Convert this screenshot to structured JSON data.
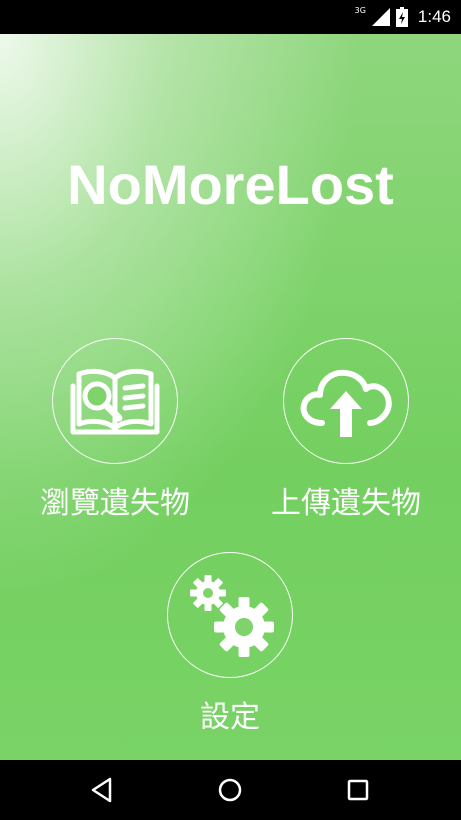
{
  "status_bar": {
    "network": "3G",
    "time": "1:46"
  },
  "app": {
    "title": "NoMoreLost",
    "background_color": "#7ed36b",
    "menu": {
      "browse_label": "瀏覽遺失物",
      "upload_label": "上傳遺失物",
      "settings_label": "設定"
    }
  },
  "icons": {
    "browse": "book-search-icon",
    "upload": "cloud-upload-icon",
    "settings": "gears-icon",
    "nav_back": "back-triangle-icon",
    "nav_home": "home-circle-icon",
    "nav_recent": "recent-apps-square-icon"
  }
}
